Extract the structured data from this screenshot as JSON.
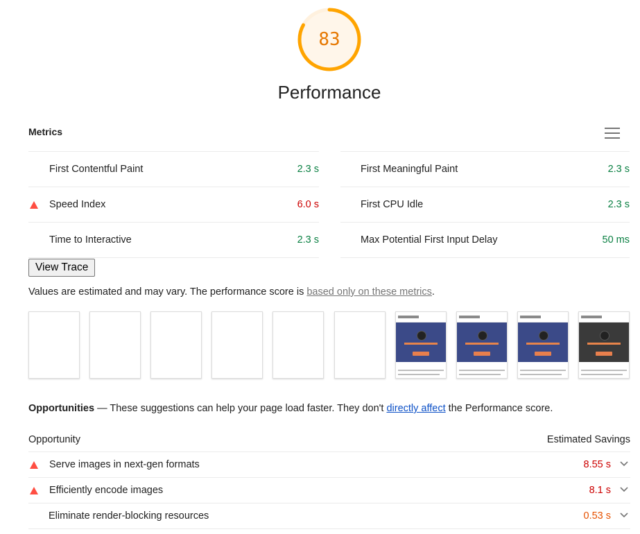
{
  "score": "83",
  "score_fraction": 0.83,
  "colors": {
    "score_arc": "#ffa400",
    "score_text": "#e67700",
    "pass": "#0b8043",
    "fail": "#cc0000",
    "average": "#e65100",
    "warn_icon": "#ff4e42"
  },
  "category_title": "Performance",
  "metrics": {
    "header": "Metrics",
    "menu_icon": "hamburger-menu-icon",
    "left": [
      {
        "title": "First Contentful Paint",
        "value": "2.3 s",
        "status": "pass"
      },
      {
        "title": "Speed Index",
        "value": "6.0 s",
        "status": "fail"
      },
      {
        "title": "Time to Interactive",
        "value": "2.3 s",
        "status": "pass"
      }
    ],
    "right": [
      {
        "title": "First Meaningful Paint",
        "value": "2.3 s",
        "status": "pass"
      },
      {
        "title": "First CPU Idle",
        "value": "2.3 s",
        "status": "pass"
      },
      {
        "title": "Max Potential First Input Delay",
        "value": "50 ms",
        "status": "pass"
      }
    ]
  },
  "view_trace_label": "View Trace",
  "disclaimer": {
    "text_before": "Values are estimated and may vary. The performance score is ",
    "link": "based only on these metrics",
    "text_after": "."
  },
  "filmstrip": {
    "frames": [
      "blank",
      "blank",
      "blank",
      "blank",
      "blank",
      "blank",
      "page",
      "page",
      "page",
      "page-photo"
    ]
  },
  "opportunities": {
    "title": "Opportunities",
    "dash": " — ",
    "description_before": "These suggestions can help your page load faster. They don't ",
    "link": "directly affect",
    "description_after": " the Performance score.",
    "col_opportunity": "Opportunity",
    "col_savings": "Estimated Savings",
    "items": [
      {
        "title": "Serve images in next-gen formats",
        "savings": "8.55 s",
        "status": "fail"
      },
      {
        "title": "Efficiently encode images",
        "savings": "8.1 s",
        "status": "fail"
      },
      {
        "title": "Eliminate render-blocking resources",
        "savings": "0.53 s",
        "status": "average"
      }
    ]
  }
}
